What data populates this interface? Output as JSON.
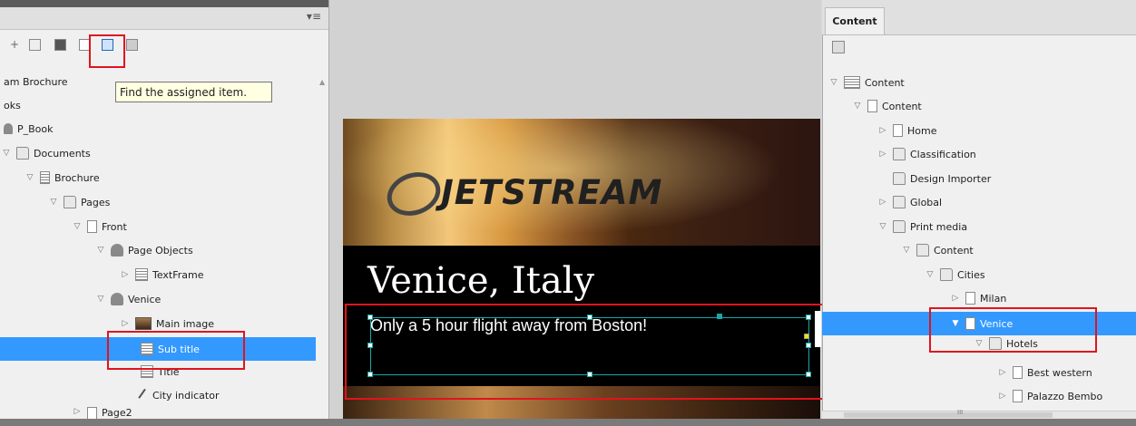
{
  "left_panel": {
    "tooltip": "Find the assigned item.",
    "tree": [
      {
        "label": "am Brochure",
        "icon": "none",
        "indent": 0
      },
      {
        "label": "oks",
        "icon": "none",
        "indent": 0
      },
      {
        "label": "P_Book",
        "icon": "book-icon",
        "indent": 0
      },
      {
        "label": "Documents",
        "icon": "folder-icon",
        "indent": 1
      },
      {
        "label": "Brochure",
        "icon": "document-icon",
        "indent": 2
      },
      {
        "label": "Pages",
        "icon": "folder-icon",
        "indent": 3
      },
      {
        "label": "Front",
        "icon": "page-icon",
        "indent": 4
      },
      {
        "label": "Page Objects",
        "icon": "objects-icon",
        "indent": 5
      },
      {
        "label": "TextFrame",
        "icon": "textframe-icon",
        "indent": 6
      },
      {
        "label": "Venice",
        "icon": "objects-icon",
        "indent": 5
      },
      {
        "label": "Main image",
        "icon": "image-icon",
        "indent": 6
      },
      {
        "label": "Sub title",
        "icon": "textframe-icon",
        "indent": 6,
        "selected": true
      },
      {
        "label": "Title",
        "icon": "textframe-icon",
        "indent": 6
      },
      {
        "label": "City indicator",
        "icon": "pin-icon",
        "indent": 6
      },
      {
        "label": "Page2",
        "icon": "page-icon",
        "indent": 4
      }
    ]
  },
  "canvas": {
    "brand": "JETSTREAM",
    "title": "Venice, Italy",
    "subtitle": "Only a 5 hour flight away from Boston!"
  },
  "right_panel": {
    "tab": "Content",
    "tree": [
      {
        "label": "Content",
        "icon": "content-root-icon",
        "expanded": true
      },
      {
        "label": "Content",
        "icon": "page-icon",
        "expanded": true
      },
      {
        "label": "Home",
        "icon": "page-icon",
        "expanded": false
      },
      {
        "label": "Classification",
        "icon": "folder-icon",
        "expanded": false
      },
      {
        "label": "Design Importer",
        "icon": "folder-icon",
        "expanded": null
      },
      {
        "label": "Global",
        "icon": "folder-icon",
        "expanded": false
      },
      {
        "label": "Print media",
        "icon": "folder-icon",
        "expanded": true
      },
      {
        "label": "Content",
        "icon": "folder-icon",
        "expanded": true
      },
      {
        "label": "Cities",
        "icon": "folder-icon",
        "expanded": true
      },
      {
        "label": "Milan",
        "icon": "page-icon",
        "expanded": false
      },
      {
        "label": "Venice",
        "icon": "page-icon",
        "expanded": true,
        "selected": true
      },
      {
        "label": "Hotels",
        "icon": "folder-icon",
        "expanded": true
      },
      {
        "label": "Best western",
        "icon": "page-icon",
        "expanded": false
      },
      {
        "label": "Palazzo Bembo",
        "icon": "page-icon",
        "expanded": false
      }
    ],
    "scroll_marker": "III"
  },
  "colors": {
    "selection": "#3399ff",
    "highlight_box": "#e0141e",
    "frame": "#19a6a6"
  }
}
